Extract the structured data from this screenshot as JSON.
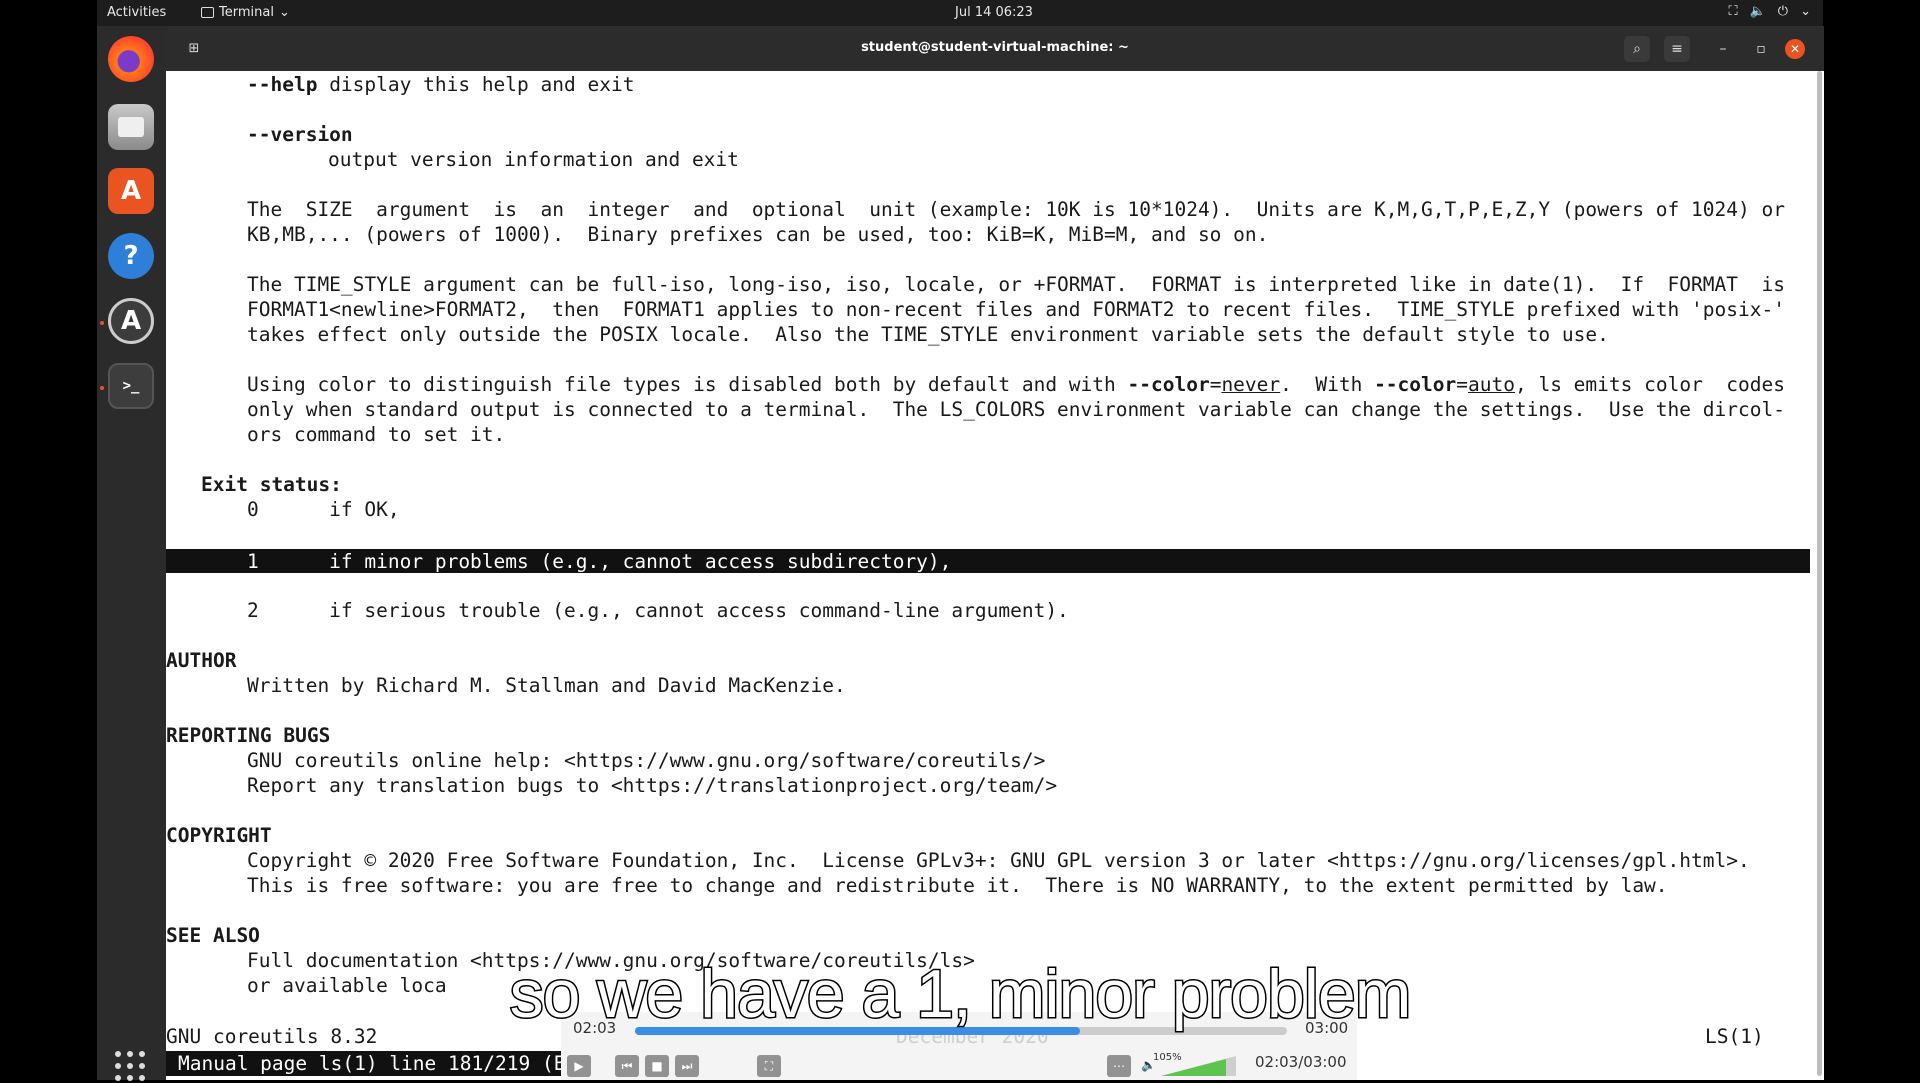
{
  "topbar": {
    "activities": "Activities",
    "app_name": "Terminal",
    "clock": "Jul 14  06:23"
  },
  "window": {
    "title": "student@student-virtual-machine: ~"
  },
  "man": {
    "lines": [
      {
        "segs": [
          {
            "t": "--help",
            "b": true
          },
          {
            "t": " display this help and exit"
          }
        ]
      },
      {
        "segs": [
          {
            "t": "--version",
            "b": true
          }
        ]
      },
      {
        "segs": [
          {
            "t": "output version information and exit"
          }
        ]
      },
      {
        "segs": [
          {
            "t": "The  SIZE  argument  is  an  integer  and  optional  unit (example: 10K is 10*1024).  Units are K,M,G,T,P,E,Z,Y (powers of 1024) or"
          }
        ]
      },
      {
        "segs": [
          {
            "t": "KB,MB,... (powers of 1000).  Binary prefixes can be used, too: KiB=K, MiB=M, and so on."
          }
        ]
      },
      {
        "segs": [
          {
            "t": "The TIME_STYLE argument can be full-iso, long-iso, iso, locale, or +FORMAT.  FORMAT is interpreted like in date(1).  If  FORMAT  is"
          }
        ]
      },
      {
        "segs": [
          {
            "t": "FORMAT1<newline>FORMAT2,  then  FORMAT1 applies to non-recent files and FORMAT2 to recent files.  TIME_STYLE prefixed with 'posix-'"
          }
        ]
      },
      {
        "segs": [
          {
            "t": "takes effect only outside the POSIX locale.  Also the TIME_STYLE environment variable sets the default style to use."
          }
        ]
      },
      {
        "segs": [
          {
            "t": "Using color to distinguish file types is disabled both by default and with "
          },
          {
            "t": "--color",
            "b": true
          },
          {
            "t": "="
          },
          {
            "t": "never",
            "u": true
          },
          {
            "t": ".  With "
          },
          {
            "t": "--color",
            "b": true
          },
          {
            "t": "="
          },
          {
            "t": "auto",
            "u": true
          },
          {
            "t": ", ls emits color  codes"
          }
        ]
      },
      {
        "segs": [
          {
            "t": "only when standard output is connected to a terminal.  The LS_COLORS environment variable can change the settings.  Use the dircol-"
          }
        ]
      },
      {
        "segs": [
          {
            "t": "ors command to set it."
          }
        ]
      },
      {
        "segs": [
          {
            "t": "Exit status:",
            "b": true
          }
        ]
      },
      {
        "segs": [
          {
            "t": "0      if OK,"
          }
        ]
      },
      {
        "segs": [
          {
            "t": "1      if minor problems (e.g., cannot access subdirectory),"
          }
        ]
      },
      {
        "segs": [
          {
            "t": "2      if serious trouble (e.g., cannot access command-line argument)."
          }
        ]
      },
      {
        "segs": [
          {
            "t": "AUTHOR",
            "b": true
          }
        ]
      },
      {
        "segs": [
          {
            "t": "Written by Richard M. Stallman and David MacKenzie."
          }
        ]
      },
      {
        "segs": [
          {
            "t": "REPORTING BUGS",
            "b": true
          }
        ]
      },
      {
        "segs": [
          {
            "t": "GNU coreutils online help: <https://www.gnu.org/software/coreutils/>"
          }
        ]
      },
      {
        "segs": [
          {
            "t": "Report any translation bugs to <https://translationproject.org/team/>"
          }
        ]
      },
      {
        "segs": [
          {
            "t": "COPYRIGHT",
            "b": true
          }
        ]
      },
      {
        "segs": [
          {
            "t": "Copyright © 2020 Free Software Foundation, Inc.  License GPLv3+: GNU GPL version 3 or later <https://gnu.org/licenses/gpl.html>."
          }
        ]
      },
      {
        "segs": [
          {
            "t": "This is free software: you are free to change and redistribute it.  There is NO WARRANTY, to the extent permitted by law."
          }
        ]
      },
      {
        "segs": [
          {
            "t": "SEE ALSO",
            "b": true
          }
        ]
      },
      {
        "segs": [
          {
            "t": "Full documentation <https://www.gnu.org/software/coreutils/ls>"
          }
        ]
      },
      {
        "segs": [
          {
            "t": "or available loca"
          }
        ]
      },
      {
        "segs": [
          {
            "t": "GNU coreutils 8.32"
          }
        ]
      }
    ],
    "footer_date": "December 2020",
    "footer_right": "LS(1)",
    "status_line": "Manual page ls(1) line 181/219 (E"
  },
  "player": {
    "elapsed": "02:03",
    "total": "03:00",
    "progress_fraction": 0.683,
    "volume": "105%",
    "time_display": "02:03/03:00"
  },
  "caption": "so we have a 1, minor problem",
  "colors": {
    "accent": "#e95420",
    "highlight_bg": "#111111",
    "progress": "#3a8ee6"
  }
}
